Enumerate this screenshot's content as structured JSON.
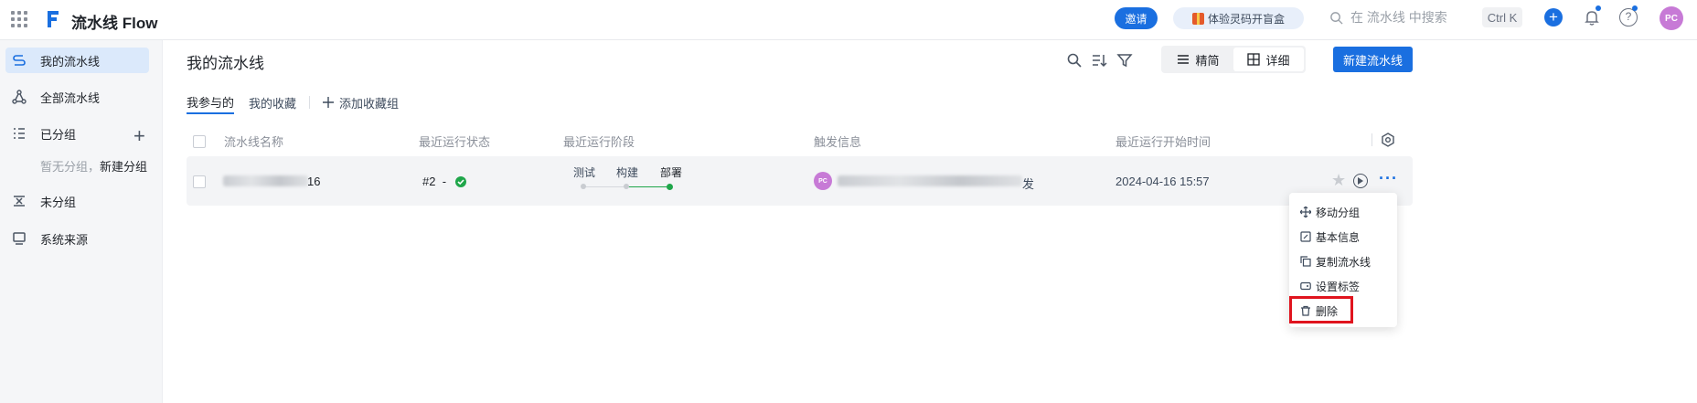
{
  "topbar": {
    "app_title": "流水线 Flow",
    "invite_label": "邀请",
    "gift_label": "体验灵码开盲盒",
    "search_placeholder": "在 流水线 中搜索",
    "shortcut": "Ctrl K",
    "user_initials": "PC"
  },
  "sidebar": {
    "items": [
      {
        "label": "我的流水线",
        "icon": "pipeline-icon"
      },
      {
        "label": "全部流水线",
        "icon": "share-nodes-icon"
      },
      {
        "label": "已分组",
        "icon": "list-icon"
      },
      {
        "label": "未分组",
        "icon": "ungrouped-icon"
      },
      {
        "label": "系统来源",
        "icon": "monitor-icon"
      }
    ],
    "empty_text": "暂无分组，",
    "empty_link": "新建分组"
  },
  "main": {
    "title": "我的流水线",
    "view_simple": "精简",
    "view_detail": "详细",
    "new_button": "新建流水线",
    "tabs": [
      "我参与的",
      "我的收藏"
    ],
    "add_group": "添加收藏组"
  },
  "table": {
    "columns": [
      "流水线名称",
      "最近运行状态",
      "最近运行阶段",
      "触发信息",
      "最近运行开始时间"
    ],
    "row": {
      "name_suffix": "16",
      "run_no": "#2",
      "run_dash": "-",
      "stages": [
        "测试",
        "构建",
        "部署"
      ],
      "trigger_initials": "PC",
      "trigger_suffix": "发",
      "start_time": "2024-04-16 15:57"
    }
  },
  "menu": {
    "items": [
      "移动分组",
      "基本信息",
      "复制流水线",
      "设置标签",
      "删除"
    ]
  },
  "colors": {
    "accent": "#1a6fe0",
    "success": "#1fa64a",
    "highlight": "#e0141e",
    "avatar": "#c77ad6"
  }
}
